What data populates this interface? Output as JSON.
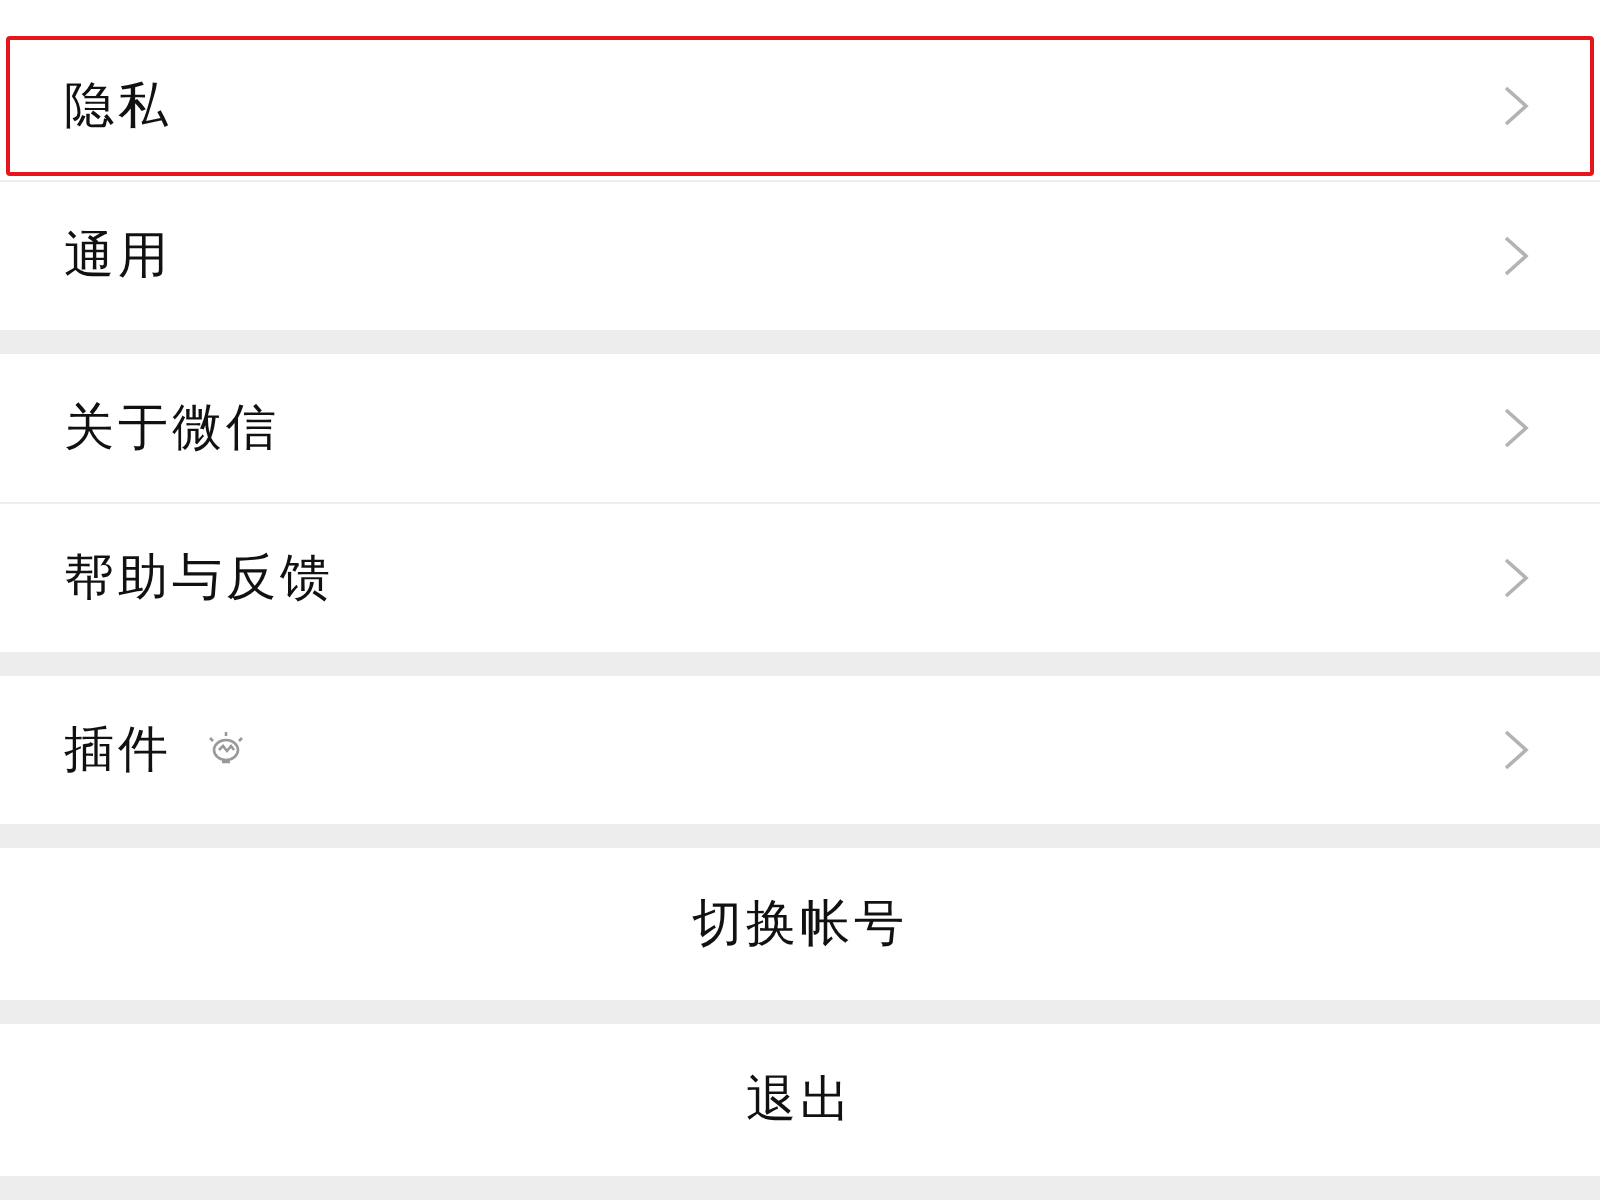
{
  "groups": [
    {
      "items": [
        {
          "label": "隐私",
          "kind": "nav",
          "highlighted": true,
          "badge": false
        },
        {
          "label": "通用",
          "kind": "nav",
          "highlighted": false,
          "badge": false
        }
      ]
    },
    {
      "items": [
        {
          "label": "关于微信",
          "kind": "nav",
          "highlighted": false,
          "badge": false
        },
        {
          "label": "帮助与反馈",
          "kind": "nav",
          "highlighted": false,
          "badge": false
        }
      ]
    },
    {
      "items": [
        {
          "label": "插件",
          "kind": "nav",
          "highlighted": false,
          "badge": true
        }
      ]
    },
    {
      "items": [
        {
          "label": "切换帐号",
          "kind": "action",
          "highlighted": false
        }
      ]
    },
    {
      "items": [
        {
          "label": "退出",
          "kind": "action",
          "highlighted": false
        }
      ]
    }
  ]
}
